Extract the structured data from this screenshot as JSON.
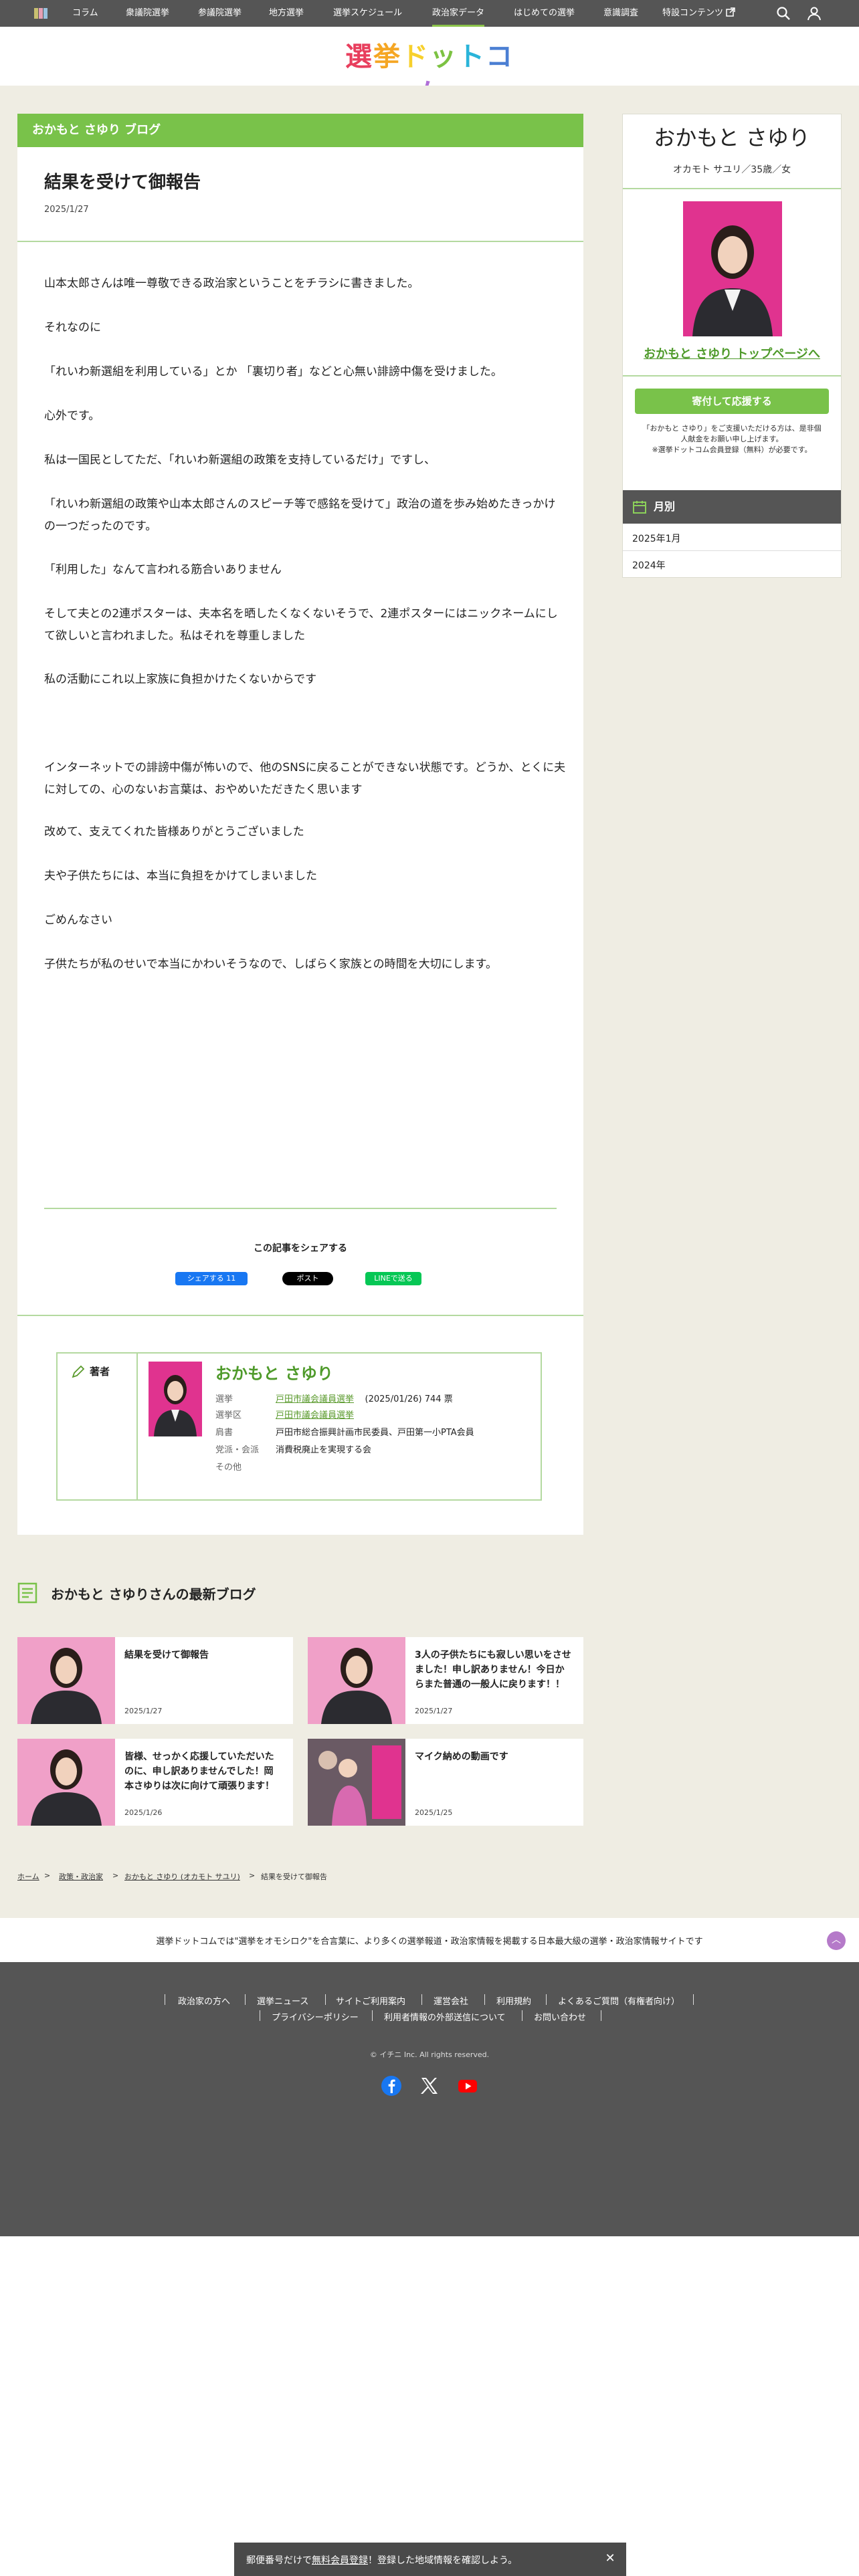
{
  "nav": {
    "items": [
      "コラム",
      "衆議院選挙",
      "参議院選挙",
      "地方選挙",
      "選挙スケジュール",
      "政治家データ",
      "はじめての選挙",
      "意識調査",
      "特設コンテンツ"
    ],
    "active_index": 5
  },
  "logo": {
    "text": "選挙ドットコム"
  },
  "article": {
    "blog_header": "おかもと さゆり ブログ",
    "title": "結果を受けて御報告",
    "date": "2025/1/27",
    "paragraphs": [
      "山本太郎さんは唯一尊敬できる政治家ということをチラシに書きました。",
      "それなのに",
      "「れいわ新選組を利用している」とか 「裏切り者」などと心無い誹謗中傷を受けました。",
      "心外です。",
      "私は一国民としてただ、「れいわ新選組の政策を支持しているだけ」ですし、",
      "「れいわ新選組の政策や山本太郎さんのスピーチ等で感銘を受けて」政治の道を歩み始めたきっかけの一つだったのです。",
      "「利用した」なんて言われる筋合いありません",
      "そして夫との2連ポスターは、夫本名を晒したくなくないそうで、2連ポスターにはニックネームにして欲しいと言われました。私はそれを尊重しました",
      "私の活動にこれ以上家族に負担かけたくないからです",
      "インターネットでの誹謗中傷が怖いので、他のSNSに戻ることができない状態です。どうか、とくに夫に対しての、心のないお言葉は、おやめいただきたく思います",
      "改めて、支えてくれた皆様ありがとうございました",
      "夫や子供たちには、本当に負担をかけてしまいました",
      "ごめんなさい",
      "子供たちが私のせいで本当にかわいそうなので、しばらく家族との時間を大切にします。"
    ],
    "share_title": "この記事をシェアする",
    "share_fb": "シェアする 11",
    "share_x": "ポスト",
    "share_line": "LINEで送る"
  },
  "author": {
    "label": "著者",
    "name": "おかもと さゆり",
    "election_key": "選挙",
    "election_value": "戸田市議会議員選挙",
    "election_result": "(2025/01/26) 744 票",
    "district_key": "選挙区",
    "district_value": "戸田市議会議員選挙",
    "title_key": "肩書",
    "title_value": "戸田市総合振興計画市民委員、戸田第一小PTA会員",
    "party_key": "党派・会派",
    "party_value": "消費税廃止を実現する会",
    "other_key": "その他"
  },
  "sidebar": {
    "name": "おかもと さゆり",
    "kana": "オカモト サユリ／35歳／女",
    "top_link": "おかもと さゆり トップページへ",
    "donate_button": "寄付して応援する",
    "note_lines": [
      "「おかもと さゆり」をご支援いただける方は、是非個",
      "人献金をお願い申し上げます。",
      "※選挙ドットコム会員登録（無料）が必要です。"
    ],
    "month_heading": "月別",
    "months": [
      "2025年1月",
      "2024年"
    ]
  },
  "latest": {
    "title": "おかもと さゆりさんの最新ブログ",
    "cards": [
      {
        "title": "結果を受けて御報告",
        "date": "2025/1/27"
      },
      {
        "title": "3人の子供たちにも寂しい思いをさせました！申し訳ありません！今日からまた普通の一般人に戻ります！！",
        "date": "2025/1/27"
      },
      {
        "title": "皆様、せっかく応援していただいたのに、申し訳ありませんでした！岡本さゆりは次に向けて頑張ります！",
        "date": "2025/1/26"
      },
      {
        "title": "マイク納めの動画です",
        "date": "2025/1/25"
      }
    ]
  },
  "breadcrumb": {
    "home": "ホーム",
    "cat": "政策・政治家",
    "person": "おかもと さゆり (オカモト サユリ)",
    "current": "結果を受けて御報告",
    "sep": ">"
  },
  "tagline": "選挙ドットコムでは\"選挙をオモシロク\"を合言葉に、より多くの選挙報道・政治家情報を掲載する日本最大級の選挙・政治家情報サイトです",
  "footer": {
    "links_row1": [
      "政治家の方へ",
      "選挙ニュース",
      "サイトご利用案内",
      "運営会社",
      "利用規約",
      "よくあるご質問（有権者向け）"
    ],
    "links_row2": [
      "プライバシーポリシー",
      "利用者情報の外部送信について",
      "お問い合わせ"
    ],
    "copyright": "© イチニ Inc. All rights reserved."
  },
  "banner": {
    "text_a": "郵便番号だけで",
    "text_link": "無料会員登録",
    "text_b": "！登録した地域情報を確認しよう。"
  },
  "colors": {
    "accent_green": "#79c24a",
    "nav_gray": "#555555",
    "beige": "#efede3",
    "portrait_pink": "#e0338f"
  }
}
